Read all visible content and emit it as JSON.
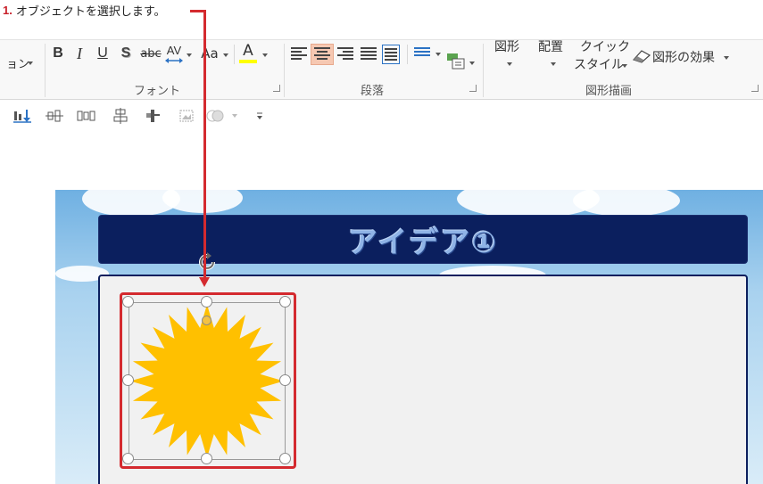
{
  "instruction": {
    "number": "1.",
    "text": "オブジェクトを選択します。"
  },
  "ribbon": {
    "left_partial_label": "ョン",
    "font_group": {
      "label": "フォント",
      "bold": "B",
      "italic": "I",
      "underline": "U",
      "shadow": "S",
      "strikethrough": "abc",
      "char_spacing": "AV",
      "change_case": "Aa",
      "font_color": "A"
    },
    "paragraph_group": {
      "label": "段落"
    },
    "drawing_group": {
      "label": "図形描画",
      "shapes_label": "図形",
      "arrange_label": "配置",
      "quick_styles_line1": "クイック",
      "quick_styles_line2": "スタイル",
      "shape_effects_label": "図形の効果"
    }
  },
  "slide": {
    "title": "アイデア①"
  },
  "colors": {
    "accent_red": "#d42a2f",
    "title_bar": "#0b1f5e",
    "sun_fill": "#ffc000",
    "font_color_bar": "#ffff00",
    "active_align": "#f6c8b2"
  }
}
